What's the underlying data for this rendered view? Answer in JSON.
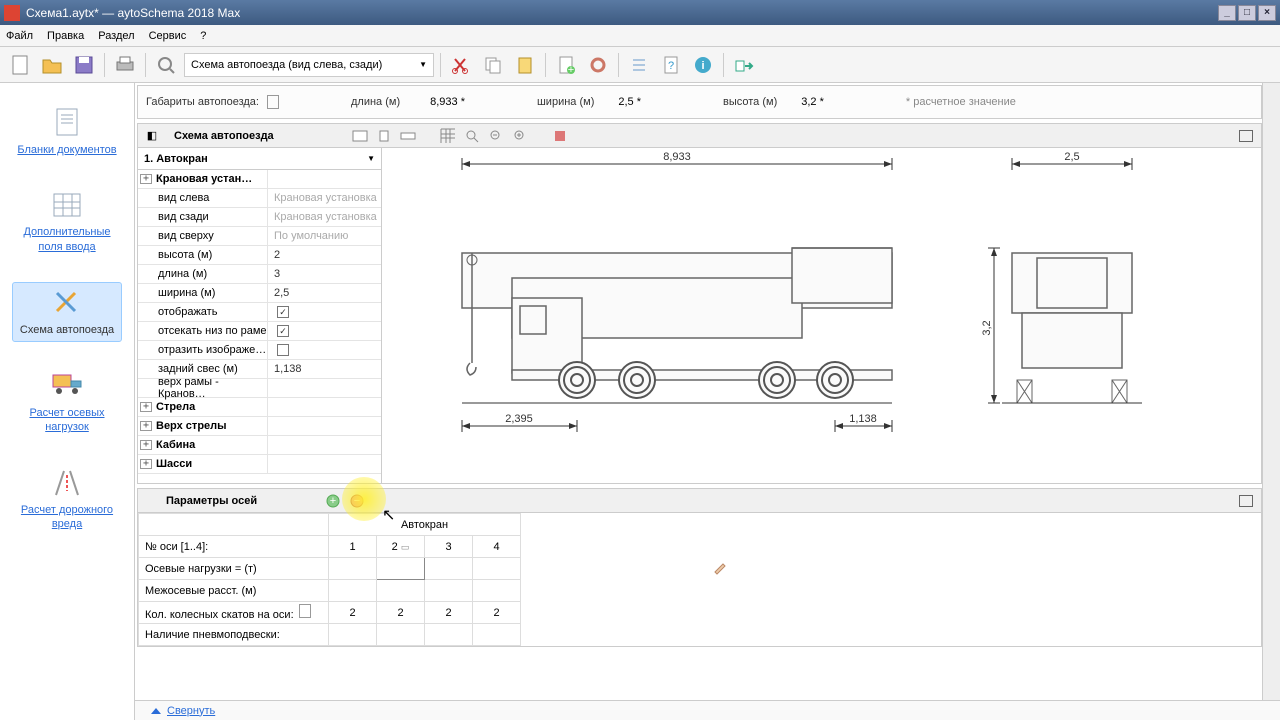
{
  "title": "Схема1.aytx*   —   aytoSchema 2018 Max",
  "menu": [
    "Файл",
    "Правка",
    "Раздел",
    "Сервис",
    "?"
  ],
  "doc_type": "Схема автопоезда (вид слева, сзади)",
  "nav": [
    {
      "label": "Бланки документов"
    },
    {
      "label": "Дополнительные поля ввода"
    },
    {
      "label": "Схема автопоезда"
    },
    {
      "label": "Расчет осевых нагрузок"
    },
    {
      "label": "Расчет дорожного вреда"
    }
  ],
  "dimensions_panel": {
    "title": "Габариты автопоезда:",
    "length_label": "длина (м)",
    "length_val": "8,933 *",
    "width_label": "ширина (м)",
    "width_val": "2,5 *",
    "height_label": "высота (м)",
    "height_val": "3,2 *",
    "note": "* расчетное значение"
  },
  "schema_panel": {
    "title": "Схема автопоезда",
    "vehicle_selector": "1. Автокран",
    "props": [
      {
        "name": "Крановая устан…",
        "bold": true,
        "exp": true
      },
      {
        "name": "вид слева",
        "val": "Крановая установка",
        "gray": true
      },
      {
        "name": "вид сзади",
        "val": "Крановая установка",
        "gray": true
      },
      {
        "name": "вид сверху",
        "val": "По умолчанию",
        "gray": true
      },
      {
        "name": "высота (м)",
        "val": "2"
      },
      {
        "name": "длина (м)",
        "val": "3"
      },
      {
        "name": "ширина (м)",
        "val": "2,5"
      },
      {
        "name": "отображать",
        "check": true
      },
      {
        "name": "отсекать низ по раме",
        "check": true
      },
      {
        "name": "отразить изображе…",
        "check": false
      },
      {
        "name": "задний свес (м)",
        "val": "1,138"
      },
      {
        "name": "верх рамы - Кранов…"
      },
      {
        "name": "Стрела",
        "bold": true,
        "exp": true
      },
      {
        "name": "Верх стрелы",
        "bold": true,
        "exp": true
      },
      {
        "name": "Кабина",
        "bold": true,
        "exp": true
      },
      {
        "name": "Шасси",
        "bold": true,
        "exp": true
      }
    ]
  },
  "drawing": {
    "side_length": "8,933",
    "front_overhang": "2,395",
    "rear_overhang": "1,138",
    "rear_width": "2,5",
    "rear_height": "3,2"
  },
  "axle_panel": {
    "title": "Параметры осей",
    "vehicle_header": "Автокран",
    "row_axle_no": "№ оси [1..4]:",
    "row_axle_loads": "Осевые нагрузки  =  (т)",
    "row_interaxle": "Межосевые расст. (м)",
    "row_wheels": "Кол. колесных скатов на оси:",
    "row_pneumo": "Наличие пневмоподвески:",
    "axle_numbers": [
      "1",
      "2",
      "3",
      "4"
    ],
    "wheel_counts": [
      "2",
      "2",
      "2",
      "2"
    ]
  },
  "collapse_label": "Свернуть"
}
